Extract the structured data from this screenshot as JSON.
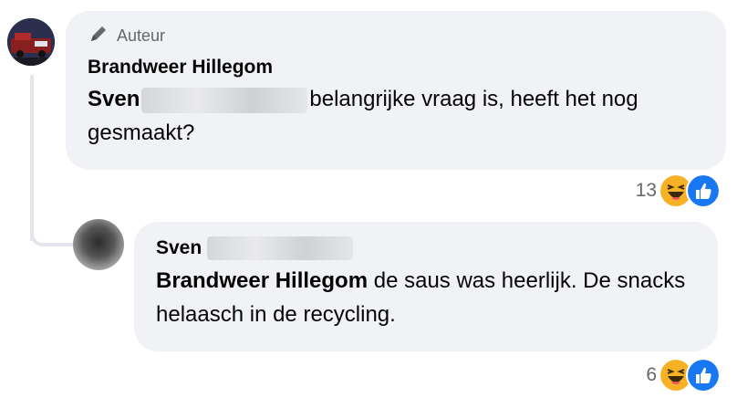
{
  "colors": {
    "bubble": "#f0f2f5",
    "muted": "#65676b",
    "like_blue": "#1877f2",
    "haha_yellow": "#f7b125"
  },
  "main_comment": {
    "badge_icon": "pencil-icon",
    "badge": "Auteur",
    "author": "Brandweer Hillegom",
    "mention": "Sven",
    "text": "belangrijke vraag is, heeft het nog gesmaakt?",
    "reaction_count": "13",
    "reactions": [
      "haha-icon",
      "like-icon"
    ]
  },
  "reply": {
    "author": "Sven",
    "mention": "Brandweer Hillegom",
    "text": "de saus was heerlijk. De snacks helaasch in de recycling.",
    "reaction_count": "6",
    "reactions": [
      "haha-icon",
      "like-icon"
    ]
  }
}
